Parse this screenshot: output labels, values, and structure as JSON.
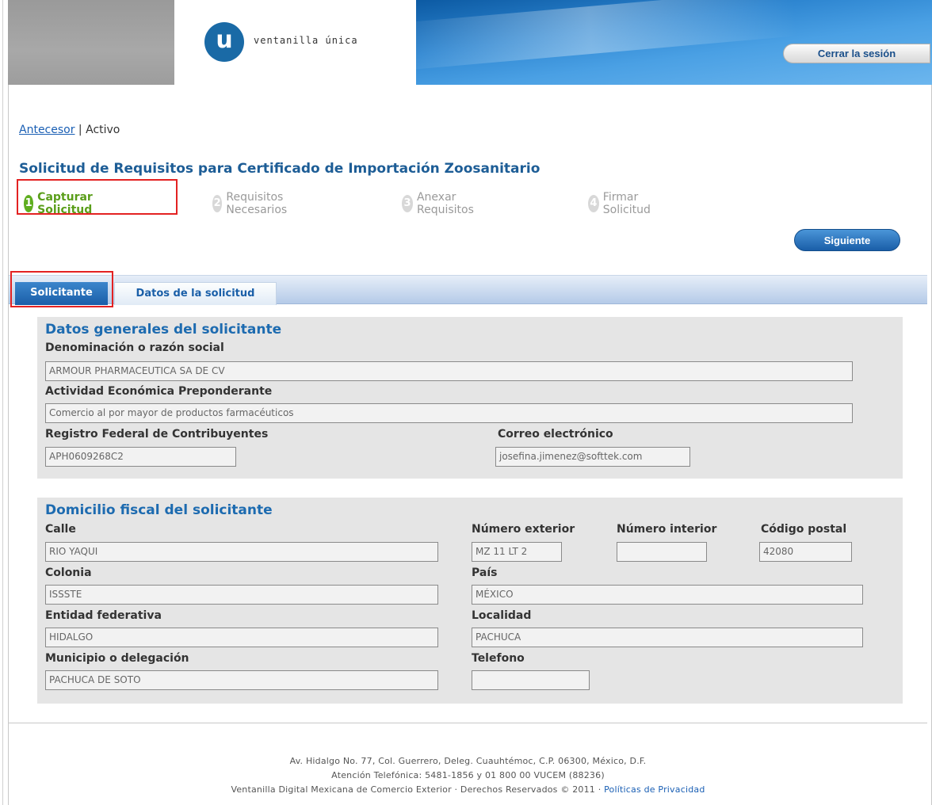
{
  "header": {
    "logo_letter": "u",
    "logo_text": "ventanilla única",
    "logout_label": "Cerrar la sesión"
  },
  "breadcrumb": {
    "link": "Antecesor",
    "separator": " | ",
    "current": "Activo"
  },
  "page_title": "Solicitud de Requisitos para Certificado de Importación Zoosanitario",
  "steps": [
    {
      "num": "1",
      "label": "Capturar Solicitud"
    },
    {
      "num": "2",
      "label": "Requisitos Necesarios"
    },
    {
      "num": "3",
      "label": "Anexar Requisitos"
    },
    {
      "num": "4",
      "label": "Firmar Solicitud"
    }
  ],
  "next_label": "Siguiente",
  "tabs": [
    {
      "label": "Solicitante"
    },
    {
      "label": "Datos de la solicitud"
    }
  ],
  "general": {
    "title": "Datos generales del solicitante",
    "denominacion_label": "Denominación o razón social",
    "denominacion_value": "ARMOUR PHARMACEUTICA SA DE CV",
    "actividad_label": "Actividad Económica Preponderante",
    "actividad_value": "Comercio al por mayor de productos farmacéuticos",
    "rfc_label": "Registro Federal de Contribuyentes",
    "rfc_value": "APH0609268C2",
    "correo_label": "Correo electrónico",
    "correo_value": "josefina.jimenez@softtek.com"
  },
  "domicilio": {
    "title": "Domicilio fiscal del solicitante",
    "calle_label": "Calle",
    "calle_value": "RIO YAQUI",
    "num_ext_label": "Número exterior",
    "num_ext_value": "MZ  11  LT  2",
    "num_int_label": "Número interior",
    "num_int_value": "",
    "cp_label": "Código postal",
    "cp_value": "42080",
    "colonia_label": "Colonia",
    "colonia_value": "ISSSTE",
    "pais_label": "País",
    "pais_value": "MÉXICO",
    "entidad_label": "Entidad federativa",
    "entidad_value": "HIDALGO",
    "localidad_label": "Localidad",
    "localidad_value": "PACHUCA",
    "municipio_label": "Municipio o delegación",
    "municipio_value": "PACHUCA DE SOTO",
    "telefono_label": "Telefono",
    "telefono_value": ""
  },
  "footer": {
    "line1": "Av. Hidalgo No. 77, Col. Guerrero, Deleg. Cuauhtémoc, C.P. 06300, México, D.F.",
    "line2": "Atención Telefónica: 5481-1856 y 01 800 00 VUCEM (88236)",
    "line3": "Ventanilla Digital Mexicana de Comercio Exterior · Derechos Reservados © 2011 · ",
    "privacy_link": "Políticas de Privacidad"
  }
}
